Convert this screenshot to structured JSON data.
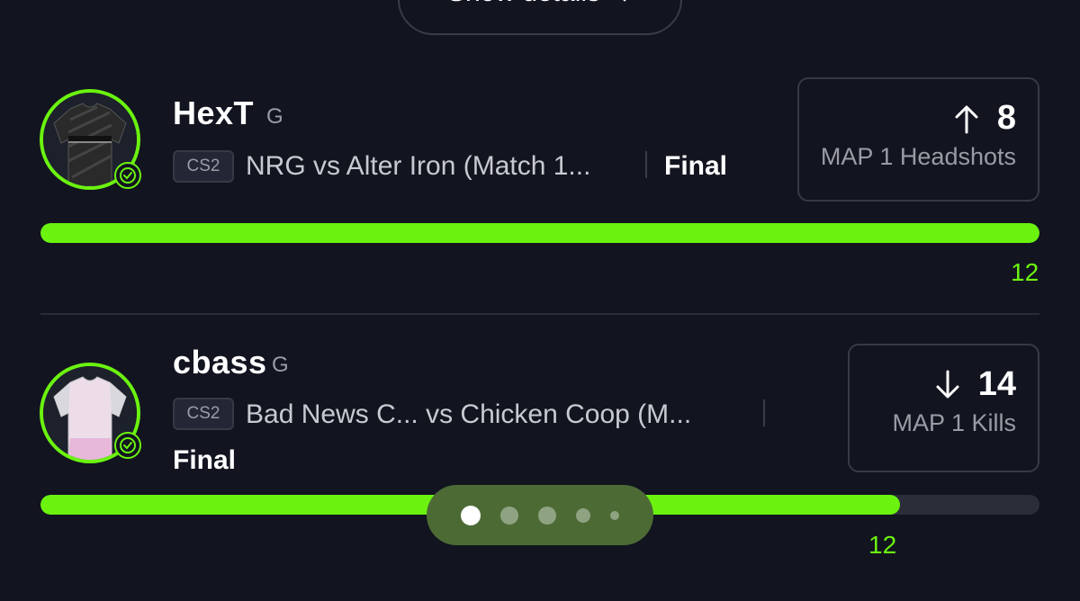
{
  "header": {
    "show_details_label": "Show details"
  },
  "picks": [
    {
      "player": "HexT",
      "position": "G",
      "game": "CS2",
      "match": "NRG vs Alter Iron (Match 1...",
      "status": "Final",
      "direction": "up",
      "line": "8",
      "stat": "MAP 1 Headshots",
      "result": "12",
      "progress_percent": 100,
      "jersey_color": "#2a2a2a",
      "icons": {
        "arrow": "arrow-up-icon",
        "check": "verified-check-icon",
        "avatar": "jersey-avatar"
      }
    },
    {
      "player": "cbass",
      "position": "G",
      "game": "CS2",
      "match": "Bad News C...  vs Chicken Coop (M...",
      "status": "Final",
      "direction": "down",
      "line": "14",
      "stat": "MAP 1 Kills",
      "result": "12",
      "progress_percent": 86,
      "jersey_color": "#ecdde9",
      "icons": {
        "arrow": "arrow-down-icon",
        "check": "verified-check-icon",
        "avatar": "jersey-avatar"
      }
    }
  ],
  "pager": {
    "total": 5,
    "active_index": 0
  },
  "colors": {
    "background": "#121420",
    "accent_green": "#6bf30f",
    "pager_bg": "#4c6b34",
    "muted_text": "#9a9ca5"
  }
}
